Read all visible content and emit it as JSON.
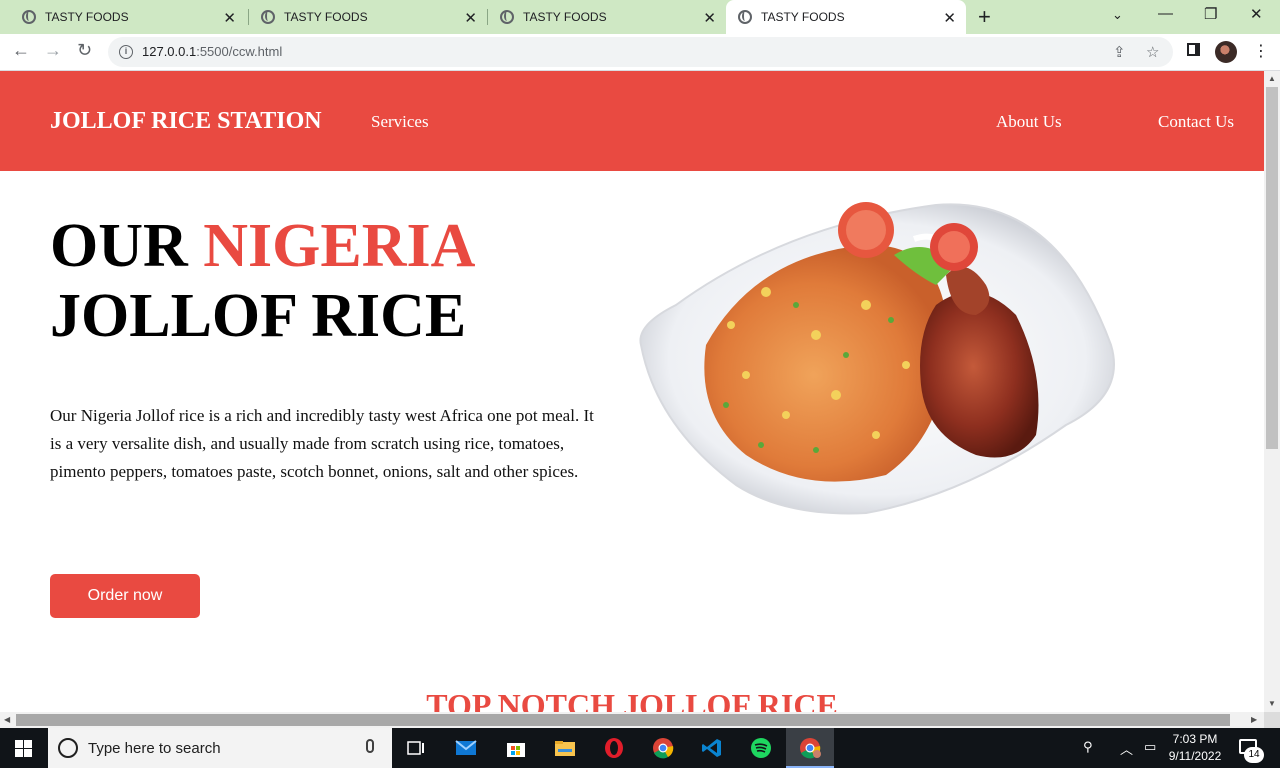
{
  "browser": {
    "tabs": [
      {
        "title": "TASTY FOODS"
      },
      {
        "title": "TASTY FOODS"
      },
      {
        "title": "TASTY FOODS"
      },
      {
        "title": "TASTY FOODS"
      }
    ],
    "active_tab": 3,
    "url_host": "127.0.0.1",
    "url_rest": ":5500/ccw.html"
  },
  "site": {
    "logo": "JOLLOF RICE STATION",
    "nav": {
      "services": "Services",
      "about": "About Us",
      "contact": "Contact Us"
    },
    "hero": {
      "title_word1": "OUR",
      "title_accent": "NIGERIA",
      "title_line2": "JOLLOF RICE",
      "description": "Our Nigeria Jollof rice is a rich and incredibly tasty west Africa one pot meal. It is a very versalite dish, and usually made from scratch using rice, tomatoes, pimento peppers, tomatoes paste, scotch bonnet, onions, salt and other spices.",
      "button": "Order now"
    },
    "section_heading": "TOP NOTCH JOLLOF RICE",
    "colors": {
      "brand": "#e94a41"
    }
  },
  "taskbar": {
    "search_placeholder": "Type here to search",
    "time": "7:03 PM",
    "date": "9/11/2022",
    "notifications": "14"
  }
}
